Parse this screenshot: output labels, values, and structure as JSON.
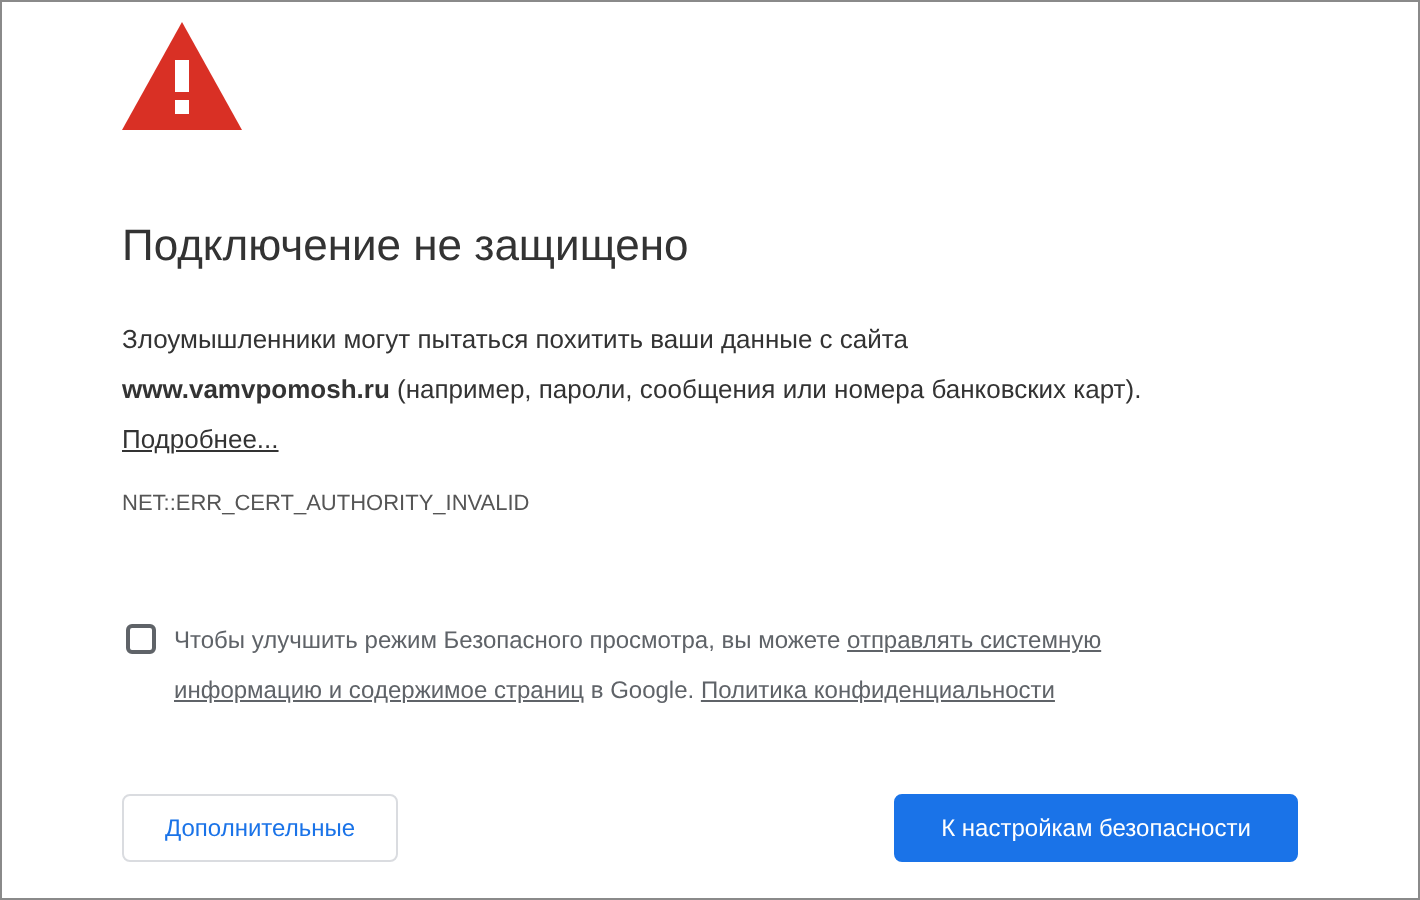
{
  "title": "Подключение не защищено",
  "description": {
    "text": "Злоумышленники могут пытаться похитить ваши данные с сайта **www.vamvpomosh.ru** (например, пароли, сообщения или номера банковских карт).",
    "link": "Подробнее..."
  },
  "error_code": "NET::ERR_CERT_AUTHORITY_INVALID",
  "report_option": {
    "checked": false,
    "parts": [
      {
        "kind": "text",
        "text": "Чтобы улучшить режим Безопасного просмотра, вы можете "
      },
      {
        "kind": "link",
        "text": "отправлять системную"
      },
      {
        "kind": "link",
        "text": "информацию и содержимое страниц"
      },
      {
        "kind": "text",
        "text": " в Google. "
      },
      {
        "kind": "link",
        "text": "Политика конфиденциальности"
      }
    ]
  },
  "buttons": [
    {
      "label": "Дополнительные",
      "kind": "secondary"
    },
    {
      "label": "К настройкам безопасности",
      "kind": "primary"
    }
  ]
}
